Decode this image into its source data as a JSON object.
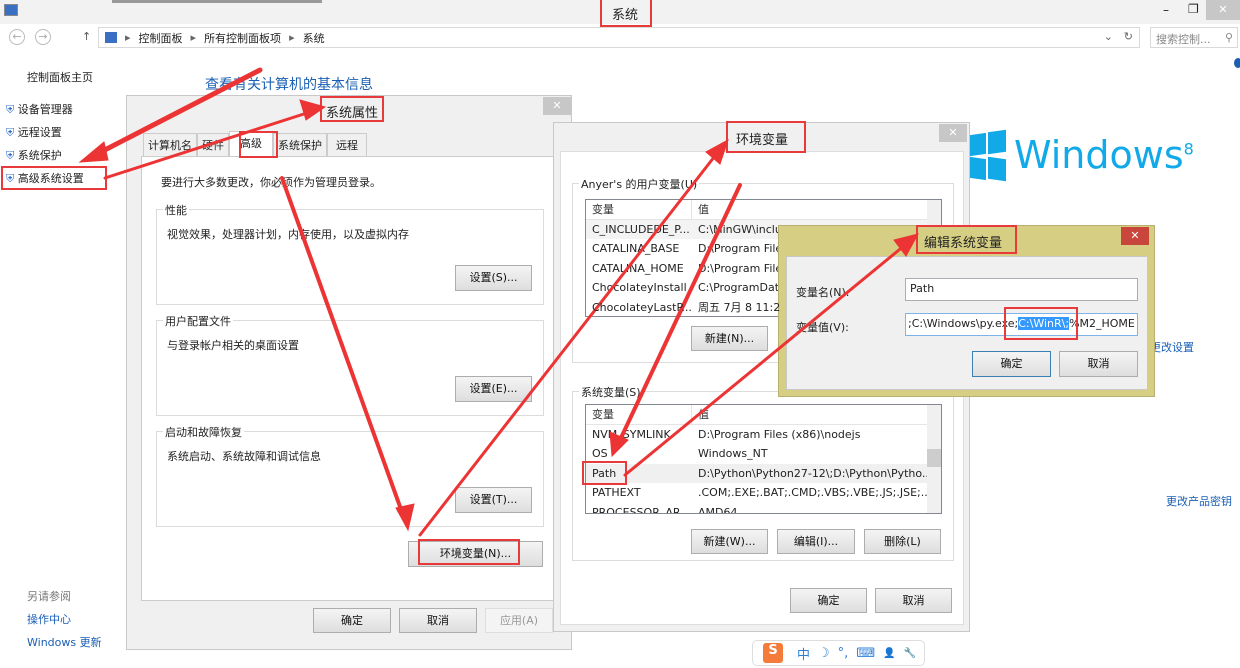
{
  "window": {
    "title": "系统",
    "min": "–",
    "max": "❐",
    "close": "✕"
  },
  "address": {
    "crumbs": [
      "控制面板",
      "所有控制面板项",
      "系统"
    ],
    "search_placeholder": "搜索控制..."
  },
  "sidebar": {
    "home": "控制面板主页",
    "items": [
      "设备管理器",
      "远程设置",
      "系统保护",
      "高级系统设置"
    ],
    "see_also": "另请参阅",
    "links": [
      "操作中心",
      "Windows 更新"
    ]
  },
  "main": {
    "heading": "查看有关计算机的基本信息",
    "logo_text": "Windows",
    "logo_sup": "8",
    "change_settings": "更改设置",
    "change_key": "更改产品密钥"
  },
  "sysprops": {
    "title": "系统属性",
    "tabs": [
      "计算机名",
      "硬件",
      "高级",
      "系统保护",
      "远程"
    ],
    "active_tab": "高级",
    "notice": "要进行大多数更改，你必须作为管理员登录。",
    "groups": [
      {
        "title": "性能",
        "desc": "视觉效果，处理器计划，内存使用，以及虚拟内存",
        "button": "设置(S)..."
      },
      {
        "title": "用户配置文件",
        "desc": "与登录帐户相关的桌面设置",
        "button": "设置(E)..."
      },
      {
        "title": "启动和故障恢复",
        "desc": "系统启动、系统故障和调试信息",
        "button": "设置(T)..."
      }
    ],
    "env_button": "环境变量(N)...",
    "ok": "确定",
    "cancel": "取消",
    "apply": "应用(A)"
  },
  "envvars": {
    "title": "环境变量",
    "user_group": "Anyer's 的用户变量(U)",
    "col_var": "变量",
    "col_val": "值",
    "user_rows": [
      [
        "C_INCLUDEDE_P...",
        "C:\\MinGW\\inclu"
      ],
      [
        "CATALINA_BASE",
        "D:\\Program File"
      ],
      [
        "CATALINA_HOME",
        "D:\\Program File"
      ],
      [
        "ChocolateyInstall",
        "C:\\ProgramDat"
      ],
      [
        "ChocolateyLastP...",
        "周五 7月 8 11:2"
      ]
    ],
    "user_new": "新建(N)...",
    "sys_group": "系统变量(S)",
    "sys_rows": [
      [
        "NVM_SYMLINK",
        "D:\\Program Files (x86)\\nodejs"
      ],
      [
        "OS",
        "Windows_NT"
      ],
      [
        "Path",
        "D:\\Python\\Python27-12\\;D:\\Python\\Pytho..."
      ],
      [
        "PATHEXT",
        ".COM;.EXE;.BAT;.CMD;.VBS;.VBE;.JS;.JSE;..."
      ],
      [
        "PROCESSOR_AR...",
        "AMD64"
      ]
    ],
    "selected_row": "Path",
    "sys_new": "新建(W)...",
    "sys_edit": "编辑(I)...",
    "sys_delete": "删除(L)",
    "ok": "确定",
    "cancel": "取消"
  },
  "editvar": {
    "title": "编辑系统变量",
    "name_label": "变量名(N):",
    "value_label": "变量值(V):",
    "name_value": "Path",
    "value_before": ";C:\\Windows\\py.exe;",
    "value_selected": "C:\\WinR\\;",
    "value_after": "%M2_HOME",
    "ok": "确定",
    "cancel": "取消"
  },
  "ime": {
    "logo": "S",
    "items": [
      "中",
      "☽",
      "°,",
      "⌨",
      "👤",
      "🔧"
    ]
  },
  "colors": {
    "annotation": "#e83a3a",
    "link": "#1a5fb4",
    "edit_frame": "#d6cf83",
    "selection": "#3399ff"
  }
}
